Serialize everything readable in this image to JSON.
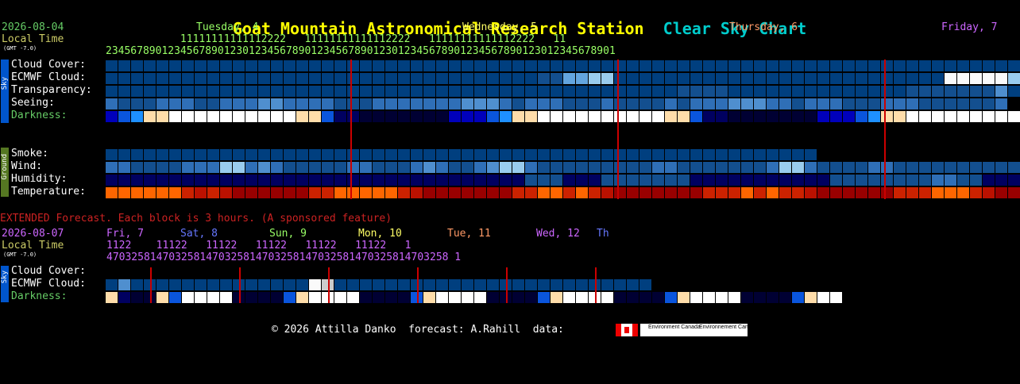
{
  "header": {
    "title": "Goat Mountain Astronomical Research Station",
    "subtitle": "Clear Sky Chart",
    "date": "2026-08-04",
    "local_time_label": "Local Time",
    "gmt_label": "(GMT -7.0)",
    "days": [
      "Tuesday, 4",
      "Wednesday, 5",
      "Thursday, 6",
      "Friday, 7"
    ],
    "hours_tens": "            11111111111112222   11111111111112222   11111111111112222   11",
    "hours_ones": "2345678901234567890123012345678901234567890123012345678901234567890123012345678901"
  },
  "sky": {
    "side_label": "Sky",
    "rows": [
      "Cloud Cover:",
      "ECMWF Cloud:",
      "Transparency:",
      "Seeing:",
      "Darkness:"
    ]
  },
  "ground": {
    "side_label": "Ground",
    "rows": [
      "Smoke:",
      "Wind:",
      "Humidity:",
      "Temperature:"
    ]
  },
  "extended": {
    "notice": "EXTENDED Forecast. Each block is 3 hours. (A sponsored feature)",
    "date": "2026-08-07",
    "local_time_label": "Local Time",
    "gmt_label": "(GMT -7.0)",
    "days": [
      "Fri, 7",
      "Sat, 8",
      "Sun, 9",
      "Mon, 10",
      "Tue, 11",
      "Wed, 12",
      "Th"
    ],
    "hours_tens": "1122    11122   11122   11122   11122   11122   1",
    "hours_ones": "4703258147032581470325814703258147032581470325814703258 1",
    "rows": [
      "Cloud Cover:",
      "ECMWF Cloud:",
      "Darkness:"
    ]
  },
  "footer": {
    "copyright": "© 2026 Attilla Danko  forecast: A.Rahill  data:",
    "logo1": "Environment Canada",
    "logo2": "Environnement Canada"
  },
  "colors": {
    "cloud_clear": "#003f7f",
    "cloud_mid": "#4f8fcf",
    "cloud_light": "#99ccee",
    "cloud_overcast": "#fafafa",
    "line": "#cc0000"
  }
}
